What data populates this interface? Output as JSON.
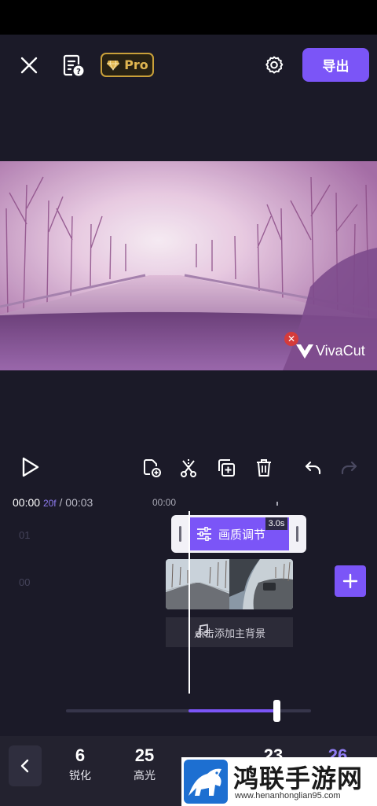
{
  "header": {
    "pro_label": "Pro",
    "export_label": "导出"
  },
  "watermark": {
    "brand": "VivaCut"
  },
  "timeline": {
    "current_time": "00:00",
    "current_frames": "20f",
    "total_time": "/ 00:03",
    "ruler_start": "00:00",
    "tracks": [
      {
        "number": "01"
      },
      {
        "number": "00"
      }
    ],
    "effect_clip": {
      "label": "画质调节",
      "duration": "3.0s"
    },
    "music_hint": "点击添加主背景"
  },
  "adjust_slider": {
    "value_fraction": 0.86,
    "fill_start_fraction": 0.5
  },
  "params": [
    {
      "value": "6",
      "label": "锐化"
    },
    {
      "value": "25",
      "label": "高光"
    },
    {
      "value": "23",
      "label": ""
    },
    {
      "value": "26",
      "label": ""
    }
  ],
  "site_badge": {
    "name": "鸿联手游网",
    "url": "www.henanhonglian95.com"
  },
  "colors": {
    "accent": "#7b55f7",
    "pro_gold": "#e0b651",
    "background": "#1b1a28"
  }
}
